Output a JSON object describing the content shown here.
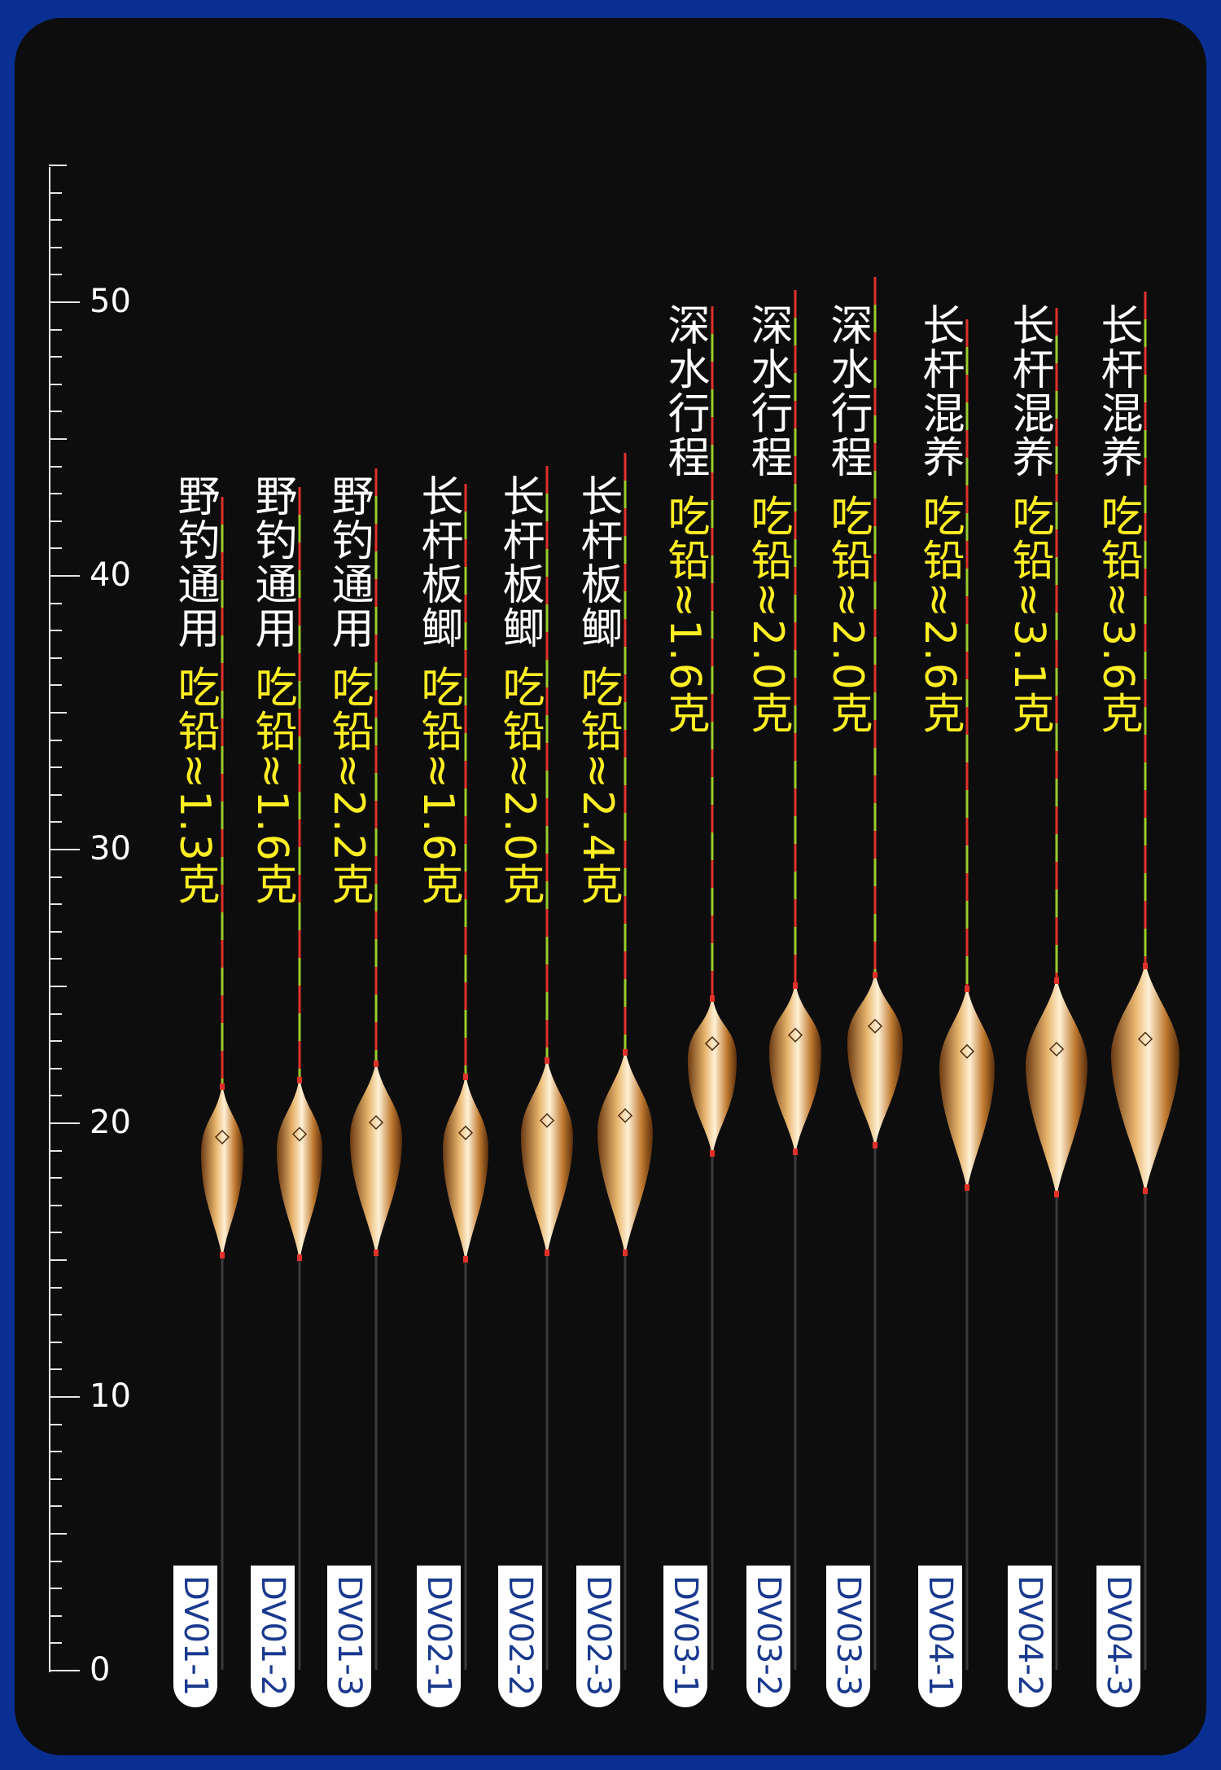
{
  "scale": {
    "labels": [
      "0",
      "10",
      "20",
      "30",
      "40",
      "50"
    ]
  },
  "floats": [
    {
      "name": "野钓通用",
      "lead_label": "吃铅≈1.3克",
      "code": "DV01-1"
    },
    {
      "name": "野钓通用",
      "lead_label": "吃铅≈1.6克",
      "code": "DV01-2"
    },
    {
      "name": "野钓通用",
      "lead_label": "吃铅≈2.2克",
      "code": "DV01-3"
    },
    {
      "name": "长杆板鲫",
      "lead_label": "吃铅≈1.6克",
      "code": "DV02-1"
    },
    {
      "name": "长杆板鲫",
      "lead_label": "吃铅≈2.0克",
      "code": "DV02-2"
    },
    {
      "name": "长杆板鲫",
      "lead_label": "吃铅≈2.4克",
      "code": "DV02-3"
    },
    {
      "name": "深水行程",
      "lead_label": "吃铅≈1.6克",
      "code": "DV03-1"
    },
    {
      "name": "深水行程",
      "lead_label": "吃铅≈2.0克",
      "code": "DV03-2"
    },
    {
      "name": "深水行程",
      "lead_label": "吃铅≈2.0克",
      "code": "DV03-3"
    },
    {
      "name": "长杆混养",
      "lead_label": "吃铅≈2.6克",
      "code": "DV04-1"
    },
    {
      "name": "长杆混养",
      "lead_label": "吃铅≈3.1克",
      "code": "DV04-2"
    },
    {
      "name": "长杆混养",
      "lead_label": "吃铅≈3.6克",
      "code": "DV04-3"
    }
  ],
  "colors": {
    "background_outer": "#0a2f93",
    "panel": "#0d0d0e",
    "float_name": "#ffffff",
    "lead_label": "#ffee22",
    "code_text": "#1a3a8f",
    "tip_red": "#e0312a",
    "tip_green": "#9ccc2a",
    "body_gold": "#c98a3a"
  }
}
